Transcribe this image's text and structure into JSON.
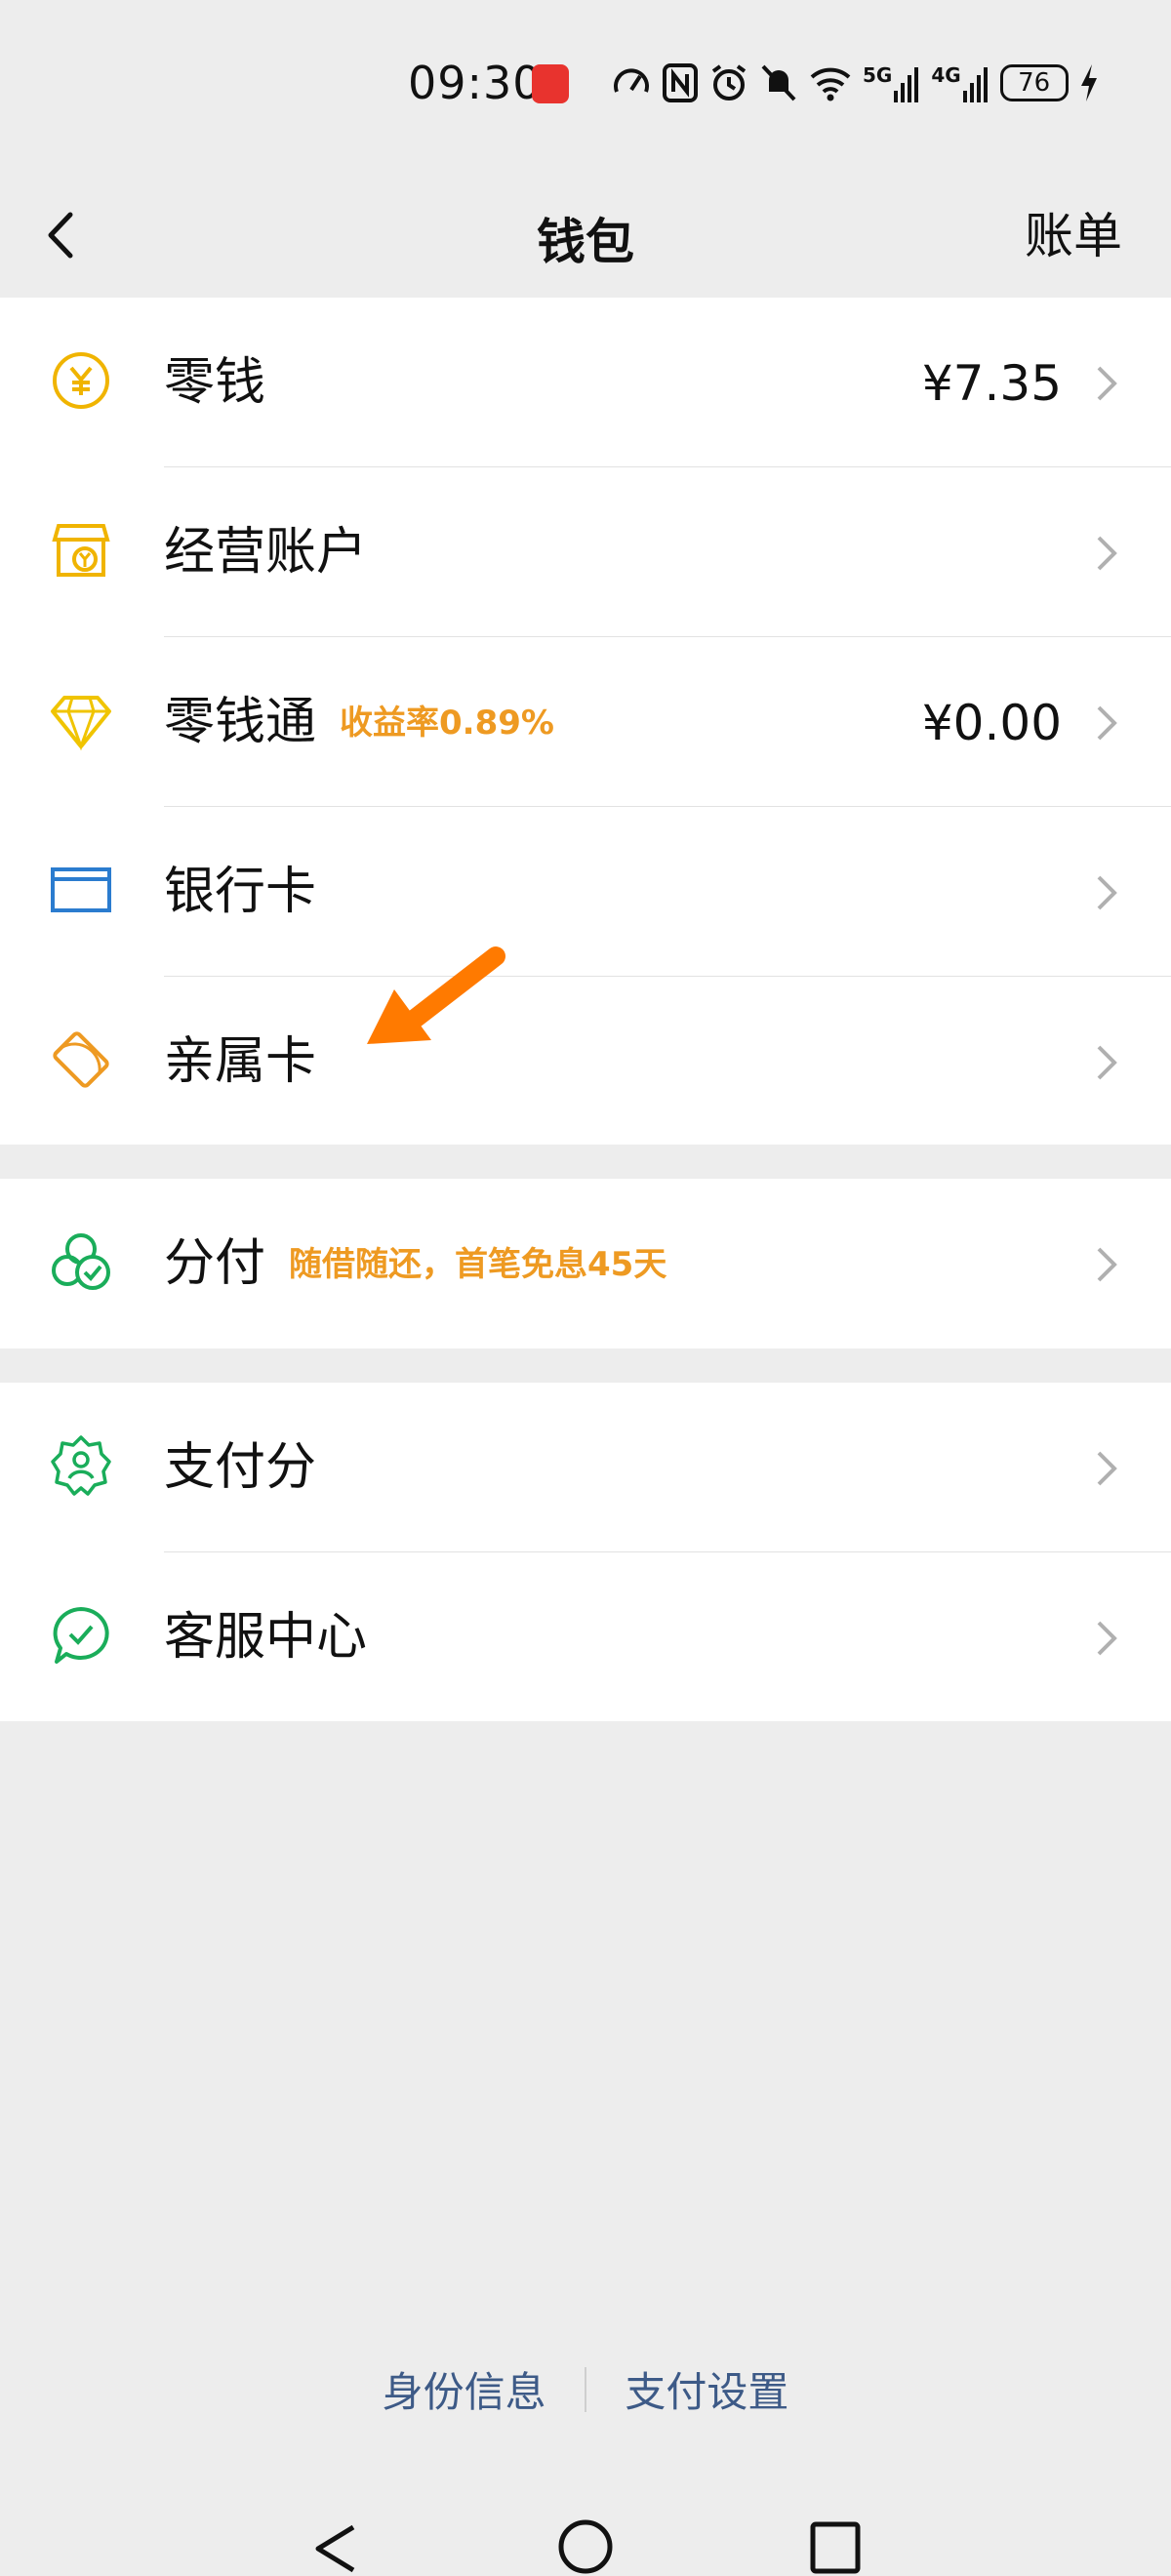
{
  "status_bar": {
    "time": "09:30",
    "network_5g": "5G",
    "network_4g": "4G",
    "battery": "76",
    "icons": [
      "notification-icon",
      "speed-icon",
      "nfc-icon",
      "alarm-icon",
      "mute-icon",
      "wifi-icon",
      "signal-5g-icon",
      "signal-4g-icon",
      "battery-icon",
      "charging-icon"
    ]
  },
  "nav": {
    "title": "钱包",
    "right_label": "账单"
  },
  "groups": {
    "g1": [
      {
        "label": "零钱",
        "amount": "¥7.35",
        "icon": "coin-icon",
        "color": "#f0b400"
      },
      {
        "label": "经营账户",
        "icon": "shop-icon",
        "color": "#f0b400"
      },
      {
        "label": "零钱通",
        "tag": "收益率0.89%",
        "amount": "¥0.00",
        "icon": "diamond-icon",
        "color": "#f0c400"
      },
      {
        "label": "银行卡",
        "icon": "bank-card-icon",
        "color": "#2b7ccf"
      },
      {
        "label": "亲属卡",
        "icon": "family-card-icon",
        "color": "#ee9a22"
      }
    ],
    "g2": [
      {
        "label": "分付",
        "tag": "随借随还，首笔免息45天",
        "icon": "fenfu-icon",
        "color": "#1aad5a"
      }
    ],
    "g3": [
      {
        "label": "支付分",
        "icon": "pay-score-icon",
        "color": "#1aad5a"
      },
      {
        "label": "客服中心",
        "icon": "service-icon",
        "color": "#1aad5a"
      }
    ]
  },
  "annotation": {
    "color": "#ff7a00"
  },
  "footer": {
    "identity": "身份信息",
    "pay_settings": "支付设置"
  },
  "colors": {
    "background": "#ededed",
    "tag": "#ee9a22",
    "footer_link": "#3d5a87"
  }
}
